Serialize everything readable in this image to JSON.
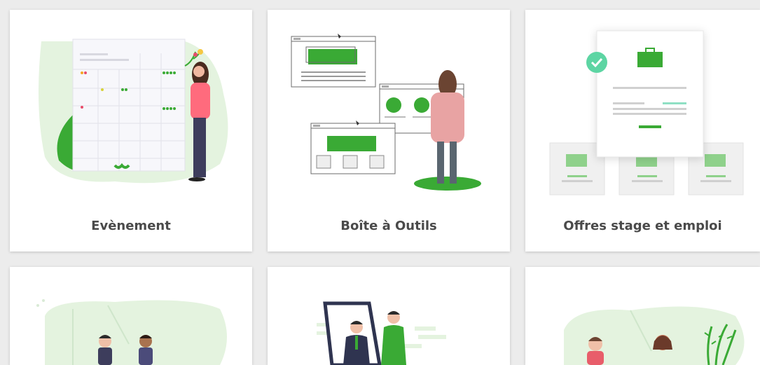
{
  "cards": [
    {
      "label": "Evènement",
      "icon": "calendar-planning-illustration"
    },
    {
      "label": "Boîte à Outils",
      "icon": "toolbox-browser-windows-illustration"
    },
    {
      "label": "Offres stage et emploi",
      "icon": "job-offers-document-illustration"
    },
    {
      "label": "",
      "icon": "meeting-people-illustration"
    },
    {
      "label": "",
      "icon": "mirror-businessman-illustration"
    },
    {
      "label": "",
      "icon": "people-plants-illustration"
    }
  ],
  "colors": {
    "accent": "#3aaa35",
    "accent_light": "#e4f3df",
    "check": "#5dd5a3",
    "label_text": "#4a4a4a",
    "background": "#ececec"
  }
}
